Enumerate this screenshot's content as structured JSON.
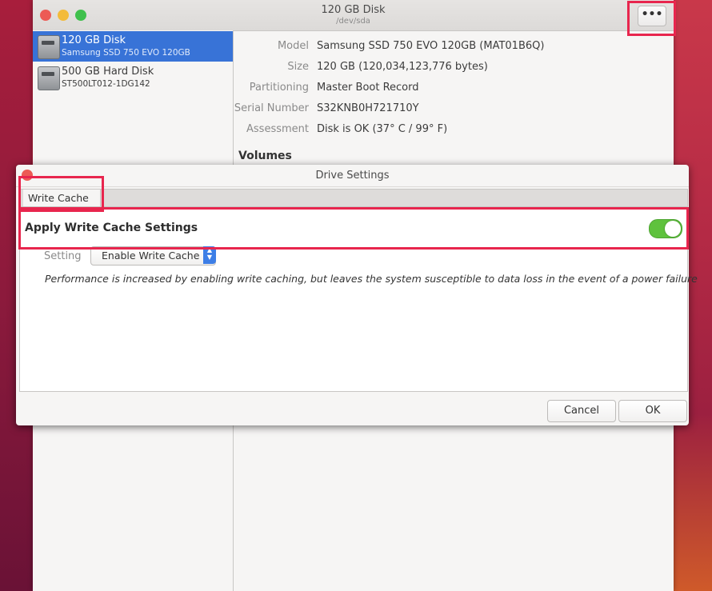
{
  "window": {
    "title": "120 GB Disk",
    "subtitle": "/dev/sda",
    "menu_button_label": "•••"
  },
  "sidebar": {
    "items": [
      {
        "name": "120 GB Disk",
        "detail": "Samsung SSD 750 EVO 120GB",
        "selected": true
      },
      {
        "name": "500 GB Hard Disk",
        "detail": "ST500LT012-1DG142",
        "selected": false
      }
    ]
  },
  "details": {
    "rows": [
      {
        "label": "Model",
        "value": "Samsung SSD 750 EVO 120GB (MAT01B6Q)"
      },
      {
        "label": "Size",
        "value": "120 GB (120,034,123,776 bytes)"
      },
      {
        "label": "Partitioning",
        "value": "Master Boot Record"
      },
      {
        "label": "Serial Number",
        "value": "S32KNB0H721710Y"
      },
      {
        "label": "Assessment",
        "value": "Disk is OK (37° C / 99° F)"
      }
    ],
    "volumes_heading": "Volumes"
  },
  "dialog": {
    "title": "Drive Settings",
    "tab_label": "Write Cache",
    "section_title": "Apply Write Cache Settings",
    "toggle_on": true,
    "setting_label": "Setting",
    "setting_value": "Enable Write Cache",
    "description": "Performance is increased by enabling write caching, but leaves the system susceptible to data loss in the event of a power failure",
    "cancel_label": "Cancel",
    "ok_label": "OK"
  },
  "colors": {
    "selection": "#3873d7",
    "toggle_on": "#5fc23d",
    "highlight": "#e8264e"
  }
}
